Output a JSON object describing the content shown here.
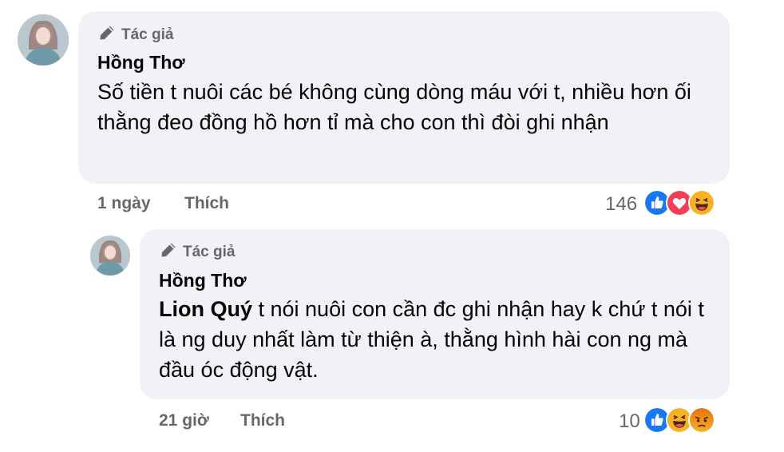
{
  "comments": [
    {
      "author_badge": "Tác giả",
      "author": "Hồng Thơ",
      "text": "Số tiền t nuôi các bé không cùng dòng máu với t, nhiều hơn ối thằng đeo đồng hồ hơn tỉ mà cho con thì đòi ghi nhận",
      "time": "1 ngày",
      "like_label": "Thích",
      "reaction_count": "146",
      "reactions": [
        "like-icon",
        "love-icon",
        "haha-icon"
      ]
    },
    {
      "author_badge": "Tác giả",
      "author": "Hồng Thơ",
      "mention": "Lion Quý",
      "text": " t nói nuôi con cần đc ghi nhận hay k chứ t nói t là ng duy nhất làm từ thiện à, thằng hình hài con ng mà đầu óc động vật.",
      "time": "21 giờ",
      "like_label": "Thích",
      "reaction_count": "10",
      "reactions": [
        "like-icon",
        "haha-icon",
        "angry-icon"
      ]
    }
  ],
  "colors": {
    "bubble": "#f0f2f5",
    "secondary_text": "#65676b",
    "like_blue": "#1877f2",
    "love_red": "#f33e58",
    "haha_yellow": "#f7b125",
    "angry_orange": "#e9710f"
  }
}
